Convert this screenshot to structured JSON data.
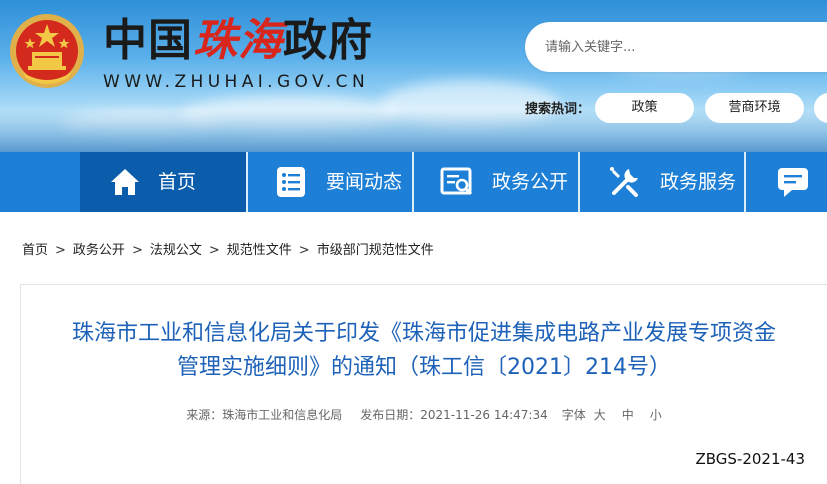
{
  "header": {
    "title_part1": "中国",
    "title_part2": "珠海",
    "title_part3": "政府",
    "url": "WWW.ZHUHAI.GOV.CN",
    "search_placeholder": "请输入关键字...",
    "hot_label": "搜索热词：",
    "hot_tags": [
      "政策",
      "营商环境"
    ]
  },
  "nav": {
    "items": [
      {
        "label": "首页",
        "icon": "home-icon"
      },
      {
        "label": "要闻动态",
        "icon": "list-icon"
      },
      {
        "label": "政务公开",
        "icon": "document-search-icon"
      },
      {
        "label": "政务服务",
        "icon": "tools-icon"
      },
      {
        "label": "",
        "icon": "chat-icon"
      }
    ]
  },
  "breadcrumb": [
    "首页",
    "政务公开",
    "法规公文",
    "规范性文件",
    "市级部门规范性文件"
  ],
  "breadcrumb_sep": ">",
  "article": {
    "title_line1": "珠海市工业和信息化局关于印发《珠海市促进集成电路产业发展专项资金",
    "title_line2": "管理实施细则》的通知（珠工信〔2021〕214号）",
    "source_label": "来源：",
    "source": "珠海市工业和信息化局",
    "date_label": "发布日期：",
    "date": "2021-11-26 14:47:34",
    "font_label": "字体",
    "font_large": "大",
    "font_medium": "中",
    "font_small": "小",
    "doc_number": "ZBGS-2021-43"
  },
  "colors": {
    "nav_bg": "#1d7fd6",
    "nav_active": "#0b5cab",
    "title_blue": "#1d62b8",
    "accent_red": "#d9261c"
  }
}
